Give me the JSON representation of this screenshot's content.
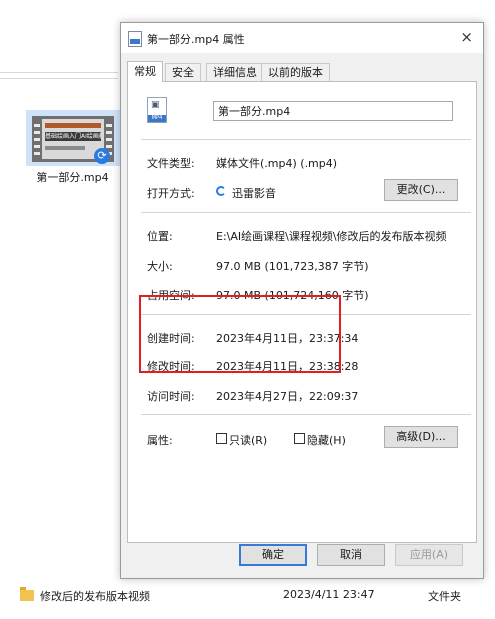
{
  "explorer": {
    "thumbnail_label": "第一部分.mp4",
    "thumbnail_banner": "基础绘画入门AI绘画教程",
    "row": {
      "name": "修改后的发布版本视频",
      "date": "2023/4/11 23:47",
      "type": "文件夹"
    }
  },
  "dialog": {
    "title": "第一部分.mp4 属性",
    "close_glyph": "×",
    "tabs": [
      {
        "label": "常规"
      },
      {
        "label": "安全"
      },
      {
        "label": "详细信息"
      },
      {
        "label": "以前的版本"
      }
    ],
    "file_icon_tag": "MP4",
    "filename_value": "第一部分.mp4",
    "rows": {
      "type_label": "文件类型:",
      "type_value": "媒体文件(.mp4) (.mp4)",
      "open_label": "打开方式:",
      "open_value": "迅雷影音",
      "change_button": "更改(C)...",
      "location_label": "位置:",
      "location_value": "E:\\AI绘画课程\\课程视频\\修改后的发布版本视频",
      "size_label": "大小:",
      "size_value": "97.0 MB (101,723,387 字节)",
      "disk_label": "占用空间:",
      "disk_value": "97.0 MB (101,724,160 字节)",
      "created_label": "创建时间:",
      "created_value": "2023年4月11日，23:37:34",
      "modified_label": "修改时间:",
      "modified_value": "2023年4月11日，23:38:28",
      "accessed_label": "访问时间:",
      "accessed_value": "2023年4月27日，22:09:37",
      "attributes_label": "属性:",
      "readonly_label": "只读(R)",
      "hidden_label": "隐藏(H)",
      "advanced_button": "高级(D)..."
    },
    "buttons": {
      "ok": "确定",
      "cancel": "取消",
      "apply": "应用(A)"
    }
  }
}
